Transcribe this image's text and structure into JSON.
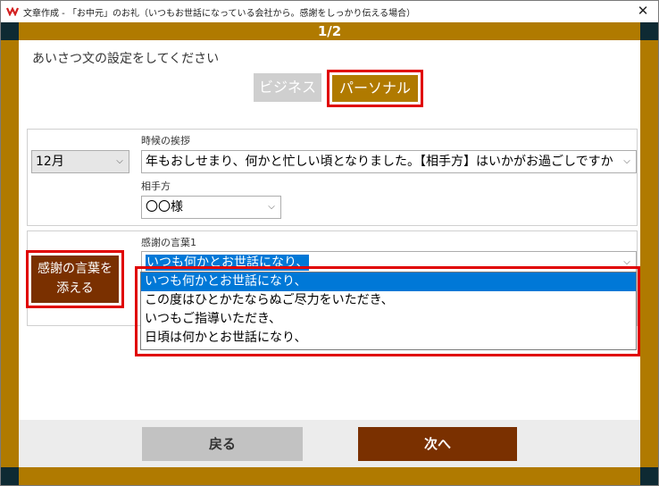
{
  "window": {
    "title": "文章作成 - 「お中元」のお礼（いつもお世話になっている会社から。感謝をしっかり伝える場合）",
    "close_glyph": "✕"
  },
  "header": {
    "page_indicator": "1/2"
  },
  "main": {
    "instruction": "あいさつ文の設定をしてください",
    "tabs": {
      "business": "ビジネス",
      "personal": "パーソナル",
      "selected": "personal"
    },
    "seasonal": {
      "month_value": "12月",
      "greeting_label": "時候の挨拶",
      "greeting_value": "年もおしせまり、何かと忙しい頃となりました。【相手方】はいかがお過ごしですか"
    },
    "recipient": {
      "label": "相手方",
      "value": "〇〇様"
    },
    "thanks": {
      "add_button": "感謝の言葉を添える",
      "label": "感謝の言葉1",
      "value": "いつも何かとお世話になり、",
      "options": [
        "いつも何かとお世話になり、",
        "この度はひとかたならぬご尽力をいただき、",
        "いつもご指導いただき、",
        "日頃は何かとお世話になり、"
      ]
    }
  },
  "footer": {
    "back_label": "戻る",
    "next_label": "次へ"
  },
  "colors": {
    "frame": "#b07a00",
    "accent_brown": "#7a3000",
    "highlight_red": "#e00000",
    "selection_blue": "#0078d7"
  },
  "icons": {
    "app": "app-logo-icon",
    "dropdown": "chevron-down-icon"
  }
}
